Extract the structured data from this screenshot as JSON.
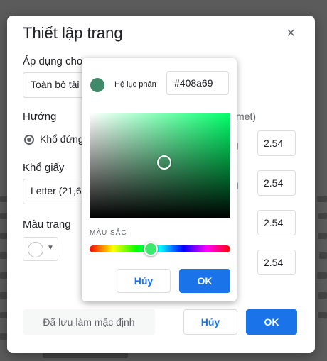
{
  "dialog": {
    "title": "Thiết lập trang",
    "close_icon": "×",
    "apply_label": "Áp dụng cho",
    "apply_value": "Toàn bộ tài",
    "orientation_label": "Hướng",
    "orientation_option": "Khổ đứng",
    "paper_label": "Khổ giấy",
    "paper_value": "Letter (21,6",
    "page_color_label": "Màu trang",
    "margins_header": "timet)",
    "margin_labels": [
      "ng",
      "ng"
    ],
    "margins": [
      "2.54",
      "2.54",
      "2.54",
      "2.54"
    ],
    "default_button": "Đã lưu làm mặc định",
    "cancel_button": "Hủy",
    "ok_button": "OK"
  },
  "picker": {
    "label": "Hệ lục phân",
    "hex": "#408a69",
    "section": "MÀU SẮC",
    "cancel_button": "Hủy",
    "ok_button": "OK",
    "color": "#408a69"
  },
  "colors": {
    "accent": "#1a73e8",
    "dialog_bg": "#ffffff",
    "overlay": "#595959"
  }
}
